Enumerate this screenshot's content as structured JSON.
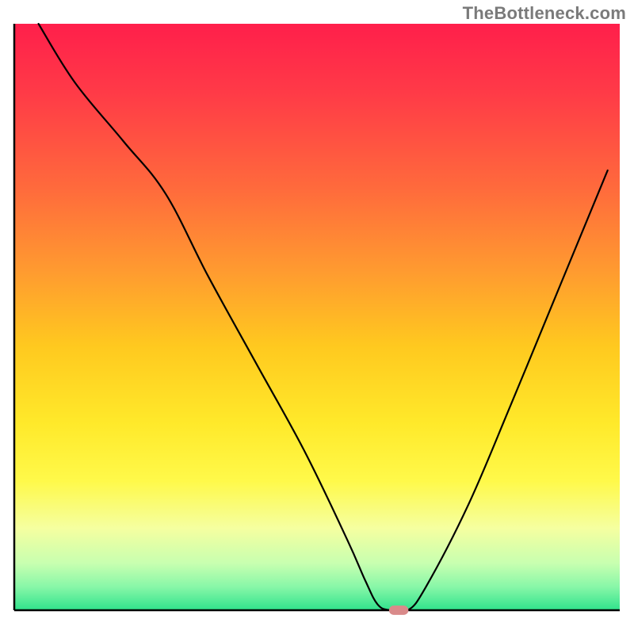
{
  "watermark": "TheBottleneck.com",
  "chart_data": {
    "type": "line",
    "title": "",
    "xlabel": "",
    "ylabel": "",
    "xlim": [
      0,
      100
    ],
    "ylim": [
      0,
      100
    ],
    "grid": false,
    "axes": {
      "left": true,
      "bottom": true,
      "right": false,
      "top": false
    },
    "background": {
      "type": "vertical-gradient",
      "stops": [
        {
          "pos": 0.0,
          "color": "#ff1f4b"
        },
        {
          "pos": 0.12,
          "color": "#ff3b47"
        },
        {
          "pos": 0.28,
          "color": "#ff6a3c"
        },
        {
          "pos": 0.42,
          "color": "#ff9a30"
        },
        {
          "pos": 0.55,
          "color": "#ffc91f"
        },
        {
          "pos": 0.68,
          "color": "#ffe92a"
        },
        {
          "pos": 0.78,
          "color": "#fff94a"
        },
        {
          "pos": 0.86,
          "color": "#f5ffa0"
        },
        {
          "pos": 0.92,
          "color": "#c8ffb0"
        },
        {
          "pos": 0.96,
          "color": "#88f7a8"
        },
        {
          "pos": 1.0,
          "color": "#2fe28c"
        }
      ]
    },
    "series": [
      {
        "name": "bottleneck-curve",
        "color": "#000000",
        "width": 2.2,
        "x": [
          4,
          10,
          18,
          25,
          32,
          40,
          48,
          55,
          58,
          60,
          62,
          65,
          68,
          75,
          82,
          90,
          98
        ],
        "values": [
          100,
          90,
          80,
          71,
          57,
          42,
          27,
          12,
          5,
          1,
          0,
          0,
          4,
          18,
          35,
          55,
          75
        ]
      }
    ],
    "marker": {
      "name": "optimal-point-marker",
      "shape": "rounded-rect",
      "color": "#d98a8a",
      "x": 63.5,
      "y": 0,
      "w": 3.2,
      "h": 1.6
    }
  }
}
